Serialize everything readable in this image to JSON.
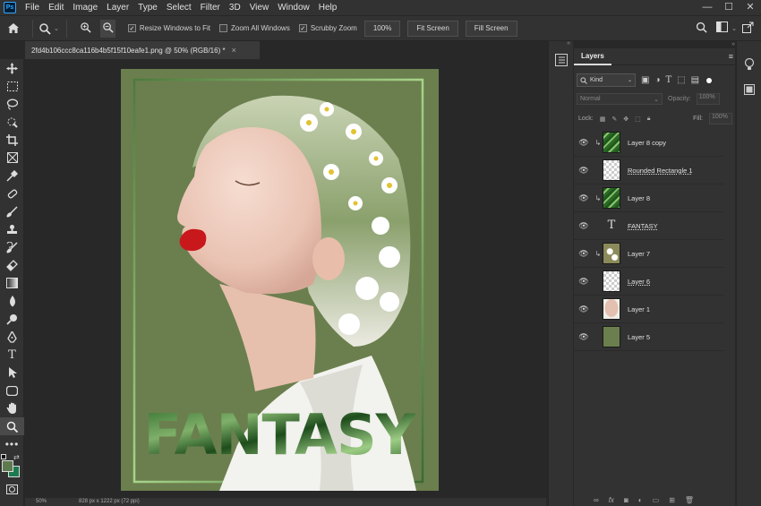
{
  "menu": {
    "logo": "Ps",
    "items": [
      "File",
      "Edit",
      "Image",
      "Layer",
      "Type",
      "Select",
      "Filter",
      "3D",
      "View",
      "Window",
      "Help"
    ],
    "win": [
      "—",
      "☐",
      "✕"
    ]
  },
  "options": {
    "resize_windows": "Resize Windows to Fit",
    "resize_checked": true,
    "zoom_all": "Zoom All Windows",
    "zoom_all_checked": false,
    "scrubby": "Scrubby Zoom",
    "scrubby_checked": true,
    "zoom_value": "100%",
    "fit_screen": "Fit Screen",
    "fill_screen": "Fill Screen"
  },
  "document": {
    "tab_title": "2fd4b106ccc8ca116b4b5f15f10eafe1.png @ 50% (RGB/16) *",
    "poster_text": "FANTASY"
  },
  "status": {
    "zoom": "50%",
    "dims": "828 px x 1222 px (72 ppi)"
  },
  "layers_panel": {
    "title": "Layers",
    "filter": "Kind",
    "blend": "Normal",
    "opacity_label": "Opacity:",
    "opacity": "100%",
    "lock_label": "Lock:",
    "fill_label": "Fill:",
    "fill": "100%",
    "layers": [
      {
        "name": "Layer 8 copy",
        "type": "leaves",
        "clipped": true,
        "underline": false
      },
      {
        "name": "Rounded Rectangle 1",
        "type": "transparent",
        "clipped": false,
        "underline": true
      },
      {
        "name": "Layer 8",
        "type": "leaves",
        "clipped": true,
        "underline": false
      },
      {
        "name": "FANTASY",
        "type": "text",
        "clipped": false,
        "underline": true
      },
      {
        "name": "Layer 7",
        "type": "flowers",
        "clipped": true,
        "underline": false
      },
      {
        "name": "Layer 6",
        "type": "transparent",
        "clipped": false,
        "underline": true
      },
      {
        "name": "Layer 1",
        "type": "portrait",
        "clipped": false,
        "underline": false
      },
      {
        "name": "Layer 5",
        "type": "solid",
        "clipped": false,
        "underline": false
      }
    ]
  },
  "colors": {
    "poster_bg": "#6b7f4e",
    "fg": "#5e7a4f",
    "bg": "#1c7a50",
    "lip": "#c8181c"
  }
}
